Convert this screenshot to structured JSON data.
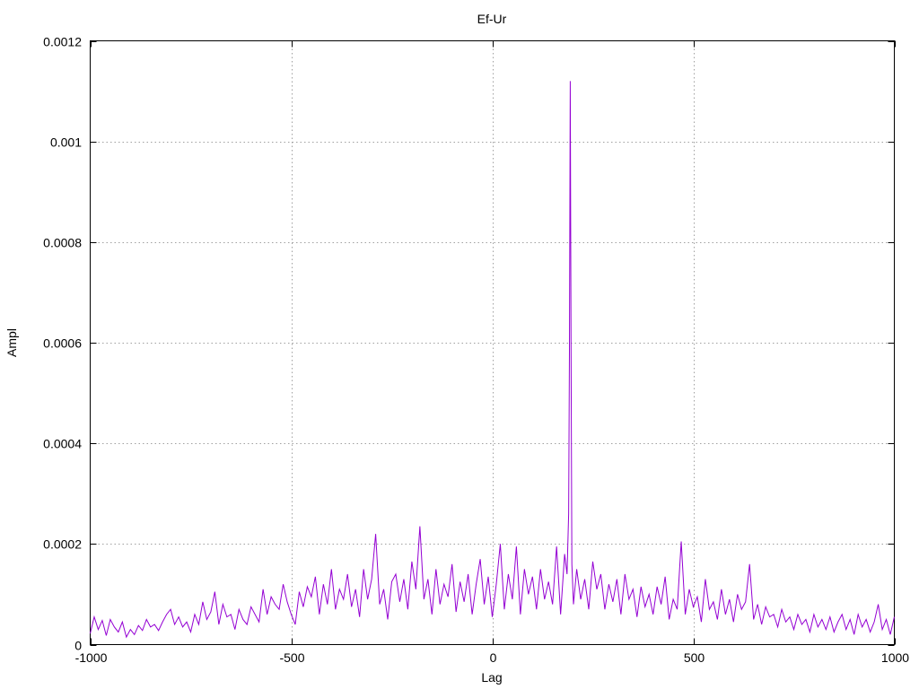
{
  "chart_data": {
    "type": "line",
    "title": "Ef-Ur",
    "xlabel": "Lag",
    "ylabel": "Ampl",
    "xlim": [
      -1000,
      1000
    ],
    "ylim": [
      0,
      0.0012
    ],
    "xticks": [
      -1000,
      -500,
      0,
      500,
      1000
    ],
    "xtick_labels": [
      "-1000",
      "-500",
      "0",
      "500",
      "1000"
    ],
    "yticks": [
      0,
      0.0002,
      0.0004,
      0.0006,
      0.0008,
      0.001,
      0.0012
    ],
    "ytick_labels": [
      "0",
      "0.0002",
      "0.0004",
      "0.0006",
      "0.0008",
      "0.001",
      "0.0012"
    ],
    "grid": true,
    "color": "#9400d3",
    "series": [
      {
        "points": [
          [
            -1000,
            2.2e-05
          ],
          [
            -990,
            5.5e-05
          ],
          [
            -980,
            3e-05
          ],
          [
            -970,
            4.8e-05
          ],
          [
            -960,
            1.8e-05
          ],
          [
            -950,
            5e-05
          ],
          [
            -940,
            3.5e-05
          ],
          [
            -930,
            2.5e-05
          ],
          [
            -920,
            4.5e-05
          ],
          [
            -910,
            1.5e-05
          ],
          [
            -900,
            3e-05
          ],
          [
            -890,
            2e-05
          ],
          [
            -880,
            3.8e-05
          ],
          [
            -870,
            2.8e-05
          ],
          [
            -860,
            5e-05
          ],
          [
            -850,
            3.5e-05
          ],
          [
            -840,
            4e-05
          ],
          [
            -830,
            2.8e-05
          ],
          [
            -820,
            4.5e-05
          ],
          [
            -810,
            6e-05
          ],
          [
            -800,
            7e-05
          ],
          [
            -790,
            4e-05
          ],
          [
            -780,
            5.5e-05
          ],
          [
            -770,
            3.5e-05
          ],
          [
            -760,
            4.5e-05
          ],
          [
            -750,
            2.5e-05
          ],
          [
            -740,
            6e-05
          ],
          [
            -730,
            4e-05
          ],
          [
            -720,
            8.5e-05
          ],
          [
            -710,
            5e-05
          ],
          [
            -700,
            6.5e-05
          ],
          [
            -690,
            0.000105
          ],
          [
            -680,
            4e-05
          ],
          [
            -670,
            8e-05
          ],
          [
            -660,
            5.5e-05
          ],
          [
            -650,
            6e-05
          ],
          [
            -640,
            3e-05
          ],
          [
            -630,
            7e-05
          ],
          [
            -620,
            5e-05
          ],
          [
            -610,
            4e-05
          ],
          [
            -600,
            7.5e-05
          ],
          [
            -590,
            6e-05
          ],
          [
            -580,
            4.5e-05
          ],
          [
            -570,
            0.00011
          ],
          [
            -560,
            6e-05
          ],
          [
            -550,
            9.5e-05
          ],
          [
            -540,
            8e-05
          ],
          [
            -530,
            7e-05
          ],
          [
            -520,
            0.00012
          ],
          [
            -510,
            8.5e-05
          ],
          [
            -500,
            6e-05
          ],
          [
            -490,
            4e-05
          ],
          [
            -480,
            0.000105
          ],
          [
            -470,
            7.5e-05
          ],
          [
            -460,
            0.000115
          ],
          [
            -450,
            9.5e-05
          ],
          [
            -440,
            0.000135
          ],
          [
            -430,
            6e-05
          ],
          [
            -420,
            0.00012
          ],
          [
            -410,
            8e-05
          ],
          [
            -400,
            0.00015
          ],
          [
            -390,
            7e-05
          ],
          [
            -380,
            0.00011
          ],
          [
            -370,
            9e-05
          ],
          [
            -360,
            0.00014
          ],
          [
            -350,
            7.5e-05
          ],
          [
            -340,
            0.00011
          ],
          [
            -330,
            5.5e-05
          ],
          [
            -320,
            0.00015
          ],
          [
            -310,
            9e-05
          ],
          [
            -300,
            0.00013
          ],
          [
            -290,
            0.00022
          ],
          [
            -280,
            8e-05
          ],
          [
            -270,
            0.00011
          ],
          [
            -260,
            5e-05
          ],
          [
            -250,
            0.000125
          ],
          [
            -240,
            0.00014
          ],
          [
            -230,
            8.5e-05
          ],
          [
            -220,
            0.00013
          ],
          [
            -210,
            7e-05
          ],
          [
            -200,
            0.000165
          ],
          [
            -190,
            0.00011
          ],
          [
            -180,
            0.000235
          ],
          [
            -170,
            9e-05
          ],
          [
            -160,
            0.00013
          ],
          [
            -150,
            6e-05
          ],
          [
            -140,
            0.00015
          ],
          [
            -130,
            8e-05
          ],
          [
            -120,
            0.00012
          ],
          [
            -110,
            9.5e-05
          ],
          [
            -100,
            0.00016
          ],
          [
            -90,
            6.5e-05
          ],
          [
            -80,
            0.000125
          ],
          [
            -70,
            8.5e-05
          ],
          [
            -60,
            0.00014
          ],
          [
            -50,
            6e-05
          ],
          [
            -40,
            0.00012
          ],
          [
            -30,
            0.00017
          ],
          [
            -20,
            8e-05
          ],
          [
            -10,
            0.000135
          ],
          [
            0,
            5.5e-05
          ],
          [
            10,
            0.00012
          ],
          [
            20,
            0.0002
          ],
          [
            30,
            7e-05
          ],
          [
            40,
            0.00014
          ],
          [
            50,
            9e-05
          ],
          [
            60,
            0.000195
          ],
          [
            70,
            6e-05
          ],
          [
            80,
            0.00015
          ],
          [
            90,
            0.0001
          ],
          [
            100,
            0.000135
          ],
          [
            110,
            7e-05
          ],
          [
            120,
            0.00015
          ],
          [
            130,
            9e-05
          ],
          [
            140,
            0.000125
          ],
          [
            150,
            8e-05
          ],
          [
            160,
            0.000195
          ],
          [
            170,
            6e-05
          ],
          [
            180,
            0.00018
          ],
          [
            186,
            0.00014
          ],
          [
            190,
            0.00026
          ],
          [
            192,
            0.00059
          ],
          [
            194,
            0.00112
          ],
          [
            196,
            0.00058
          ],
          [
            198,
            0.00016
          ],
          [
            202,
            8e-05
          ],
          [
            210,
            0.00015
          ],
          [
            220,
            9e-05
          ],
          [
            230,
            0.00013
          ],
          [
            240,
            7e-05
          ],
          [
            250,
            0.000165
          ],
          [
            260,
            0.00011
          ],
          [
            270,
            0.00014
          ],
          [
            280,
            7e-05
          ],
          [
            290,
            0.00012
          ],
          [
            300,
            8.5e-05
          ],
          [
            310,
            0.00013
          ],
          [
            320,
            6e-05
          ],
          [
            330,
            0.00014
          ],
          [
            340,
            9e-05
          ],
          [
            350,
            0.00011
          ],
          [
            360,
            5.5e-05
          ],
          [
            370,
            0.000115
          ],
          [
            380,
            7.5e-05
          ],
          [
            390,
            0.0001
          ],
          [
            400,
            6e-05
          ],
          [
            410,
            0.000115
          ],
          [
            420,
            8e-05
          ],
          [
            430,
            0.000135
          ],
          [
            440,
            5e-05
          ],
          [
            450,
            9e-05
          ],
          [
            460,
            7e-05
          ],
          [
            470,
            0.000205
          ],
          [
            480,
            6e-05
          ],
          [
            490,
            0.00011
          ],
          [
            500,
            7.5e-05
          ],
          [
            510,
            9.5e-05
          ],
          [
            520,
            4.5e-05
          ],
          [
            530,
            0.00013
          ],
          [
            540,
            7e-05
          ],
          [
            550,
            8.5e-05
          ],
          [
            560,
            5e-05
          ],
          [
            570,
            0.00011
          ],
          [
            580,
            6e-05
          ],
          [
            590,
            9e-05
          ],
          [
            600,
            4.5e-05
          ],
          [
            610,
            0.0001
          ],
          [
            620,
            7e-05
          ],
          [
            630,
            8.5e-05
          ],
          [
            640,
            0.00016
          ],
          [
            650,
            5e-05
          ],
          [
            660,
            8e-05
          ],
          [
            670,
            4e-05
          ],
          [
            680,
            7.5e-05
          ],
          [
            690,
            5.5e-05
          ],
          [
            700,
            6e-05
          ],
          [
            710,
            3.5e-05
          ],
          [
            720,
            7e-05
          ],
          [
            730,
            4.5e-05
          ],
          [
            740,
            5.5e-05
          ],
          [
            750,
            3e-05
          ],
          [
            760,
            6e-05
          ],
          [
            770,
            4e-05
          ],
          [
            780,
            5e-05
          ],
          [
            790,
            2.5e-05
          ],
          [
            800,
            6e-05
          ],
          [
            810,
            3.5e-05
          ],
          [
            820,
            5e-05
          ],
          [
            830,
            3e-05
          ],
          [
            840,
            5.5e-05
          ],
          [
            850,
            2.5e-05
          ],
          [
            860,
            4.5e-05
          ],
          [
            870,
            6e-05
          ],
          [
            880,
            3e-05
          ],
          [
            890,
            5e-05
          ],
          [
            900,
            2e-05
          ],
          [
            910,
            6e-05
          ],
          [
            920,
            3.5e-05
          ],
          [
            930,
            5e-05
          ],
          [
            940,
            2.5e-05
          ],
          [
            950,
            4.5e-05
          ],
          [
            960,
            8e-05
          ],
          [
            970,
            3e-05
          ],
          [
            980,
            5e-05
          ],
          [
            990,
            2e-05
          ],
          [
            1000,
            5.5e-05
          ]
        ]
      }
    ]
  }
}
